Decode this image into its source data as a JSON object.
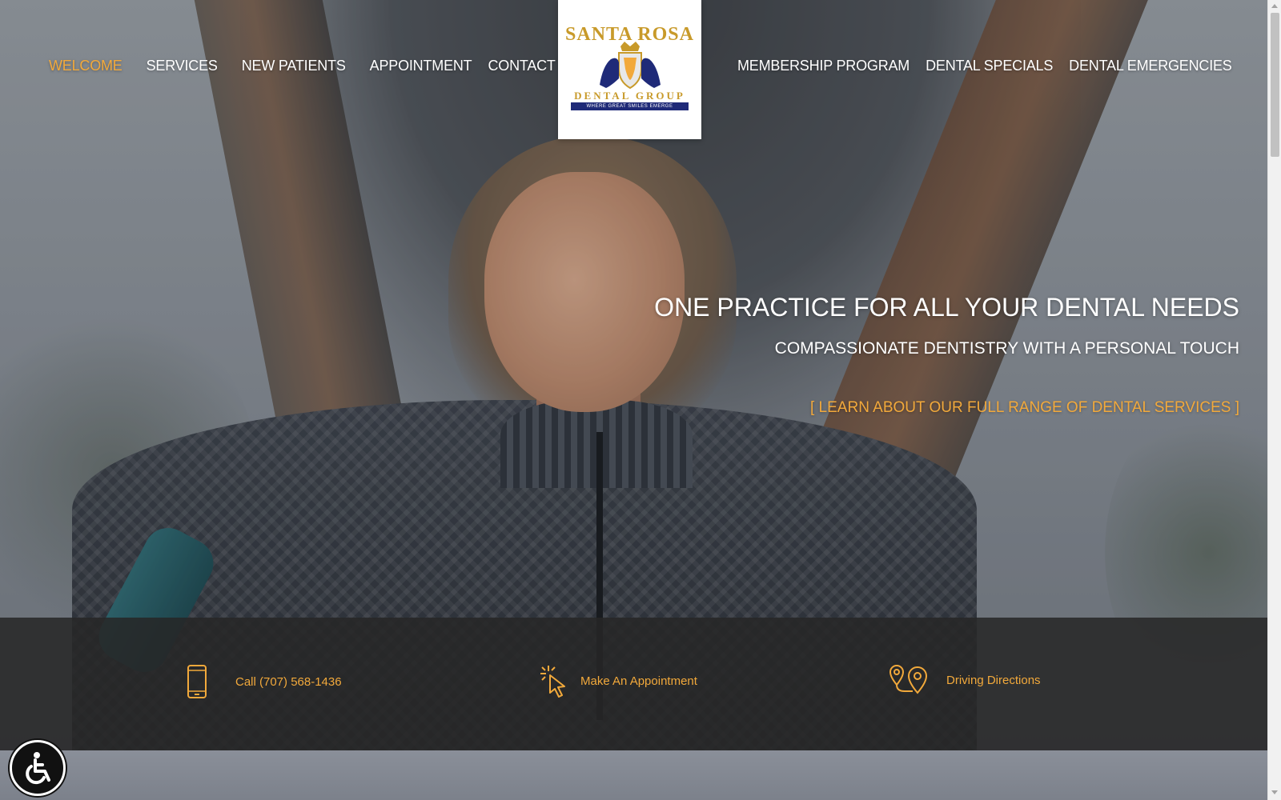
{
  "nav": {
    "left": [
      {
        "label": "WELCOME",
        "active": true
      },
      {
        "label": "SERVICES",
        "active": false
      },
      {
        "label": "NEW PATIENTS",
        "active": false
      },
      {
        "label": "APPOINTMENT",
        "active": false
      },
      {
        "label": "CONTACT",
        "active": false
      }
    ],
    "right": [
      {
        "label": "MEMBERSHIP PROGRAM"
      },
      {
        "label": "DENTAL SPECIALS"
      },
      {
        "label": "DENTAL EMERGENCIES"
      }
    ]
  },
  "logo": {
    "line1": "SANTA ROSA",
    "line2": "DENTAL GROUP",
    "tagline": "WHERE GREAT SMILES EMERGE"
  },
  "hero": {
    "headline": "ONE PRACTICE FOR ALL YOUR DENTAL NEEDS",
    "subhead": "COMPASSIONATE DENTISTRY WITH A PERSONAL TOUCH",
    "cta": "[ LEARN ABOUT OUR FULL RANGE OF DENTAL SERVICES ]"
  },
  "info_bar": {
    "call": {
      "label": "Call (707) 568-1436",
      "icon": "phone-icon"
    },
    "appointment": {
      "label": "Make An Appointment",
      "icon": "click-cursor-icon"
    },
    "directions": {
      "label": "Driving Directions",
      "icon": "map-pins-icon"
    }
  },
  "colors": {
    "accent": "#f2a93b",
    "nav_text": "#ffffff",
    "info_bar_bg": "#262626",
    "logo_gold": "#c89a2a",
    "logo_navy": "#1f2a78"
  },
  "accessibility": {
    "icon": "accessibility-icon"
  }
}
